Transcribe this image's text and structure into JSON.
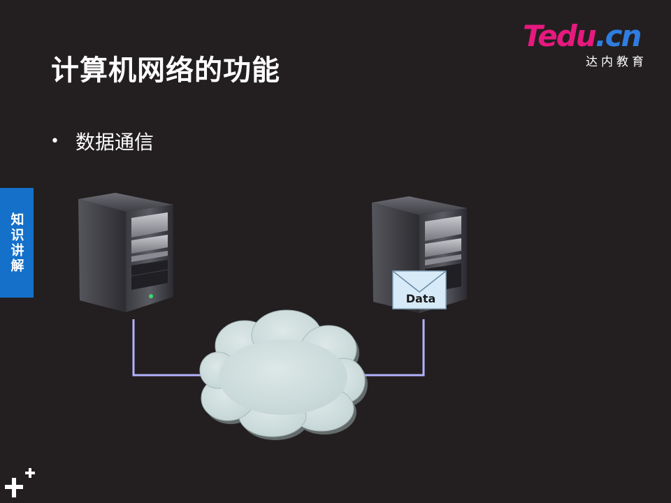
{
  "slide": {
    "title": "计算机网络的功能",
    "bullets": [
      "数据通信"
    ],
    "side_tab": "知识讲解"
  },
  "logo": {
    "t": "T",
    "edu": "edu",
    "cn": ".cn",
    "subtitle": "达内教育"
  },
  "diagram": {
    "envelope_label": "Data",
    "icons": {
      "left_server": "server-icon",
      "right_server": "server-icon",
      "cloud": "network-cloud-icon",
      "envelope": "mail-envelope-icon"
    },
    "colors": {
      "link_line": "#b3b3ff",
      "cloud_fill": "#cddcdc",
      "envelope_fill": "#d6eaf8",
      "side_tab": "#1470c9",
      "background": "#231f20"
    }
  }
}
